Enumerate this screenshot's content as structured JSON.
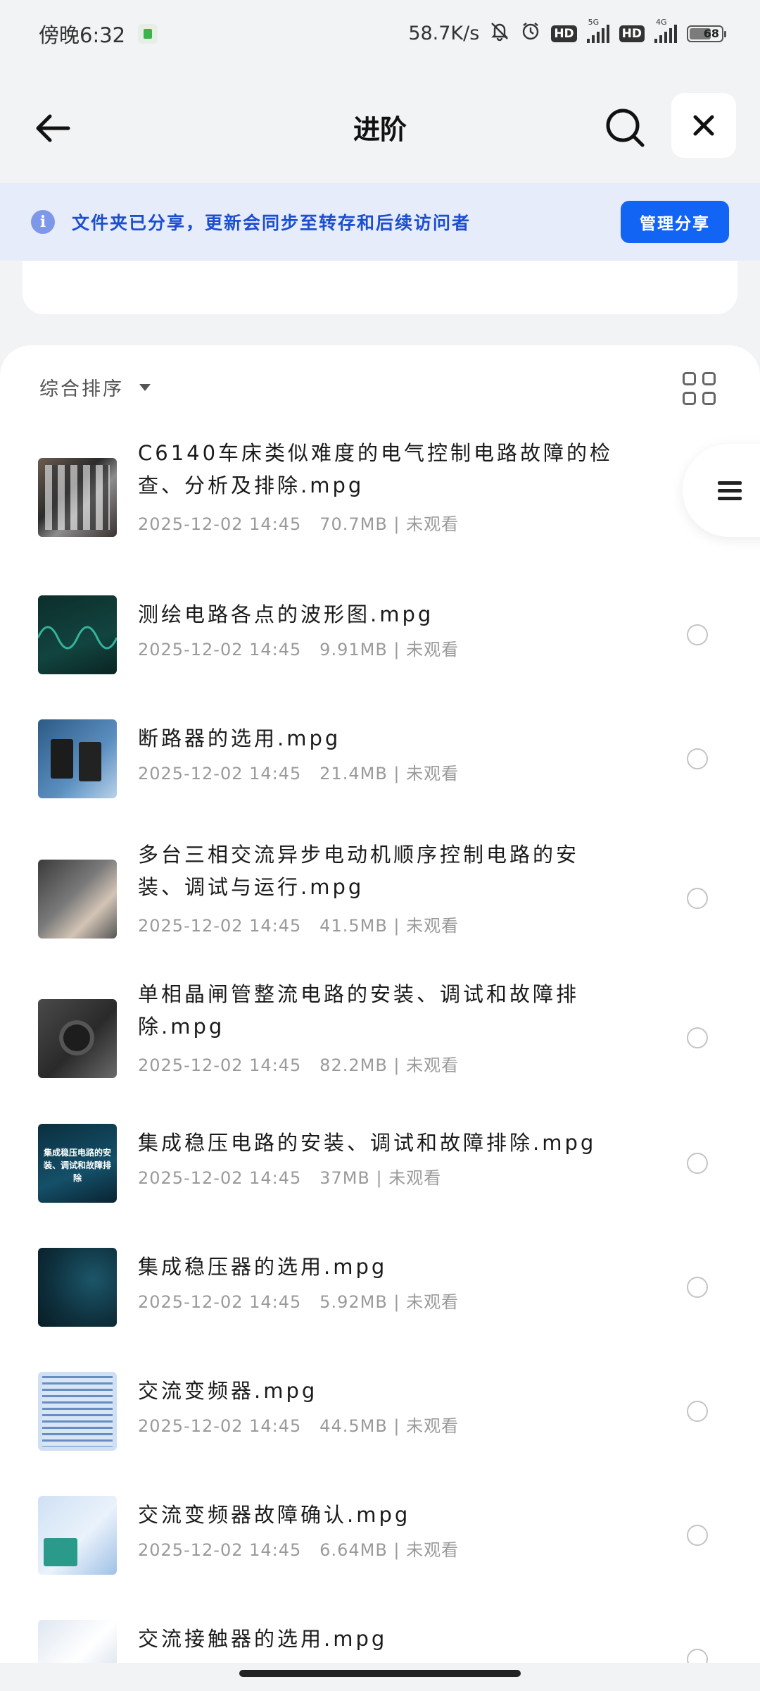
{
  "status_bar": {
    "time": "傍晚6:32",
    "network_speed": "58.7K/s",
    "hd1": "HD",
    "hd2": "HD",
    "signal1_tag": "5G",
    "signal2_tag": "4G",
    "battery_level": "68",
    "battery_fraction": 0.68
  },
  "header": {
    "title": "进阶"
  },
  "banner": {
    "text": "文件夹已分享，更新会同步至转存和后续访问者",
    "button": "管理分享"
  },
  "sort": {
    "label": "综合排序"
  },
  "files": [
    {
      "name": "C6140车床类似难度的电气控制电路故障的检查、分析及排除.mpg",
      "date": "2025-12-02  14:45",
      "size": "70.7MB",
      "status": "未观看"
    },
    {
      "name": "测绘电路各点的波形图.mpg",
      "date": "2025-12-02  14:45",
      "size": "9.91MB",
      "status": "未观看"
    },
    {
      "name": "断路器的选用.mpg",
      "date": "2025-12-02  14:45",
      "size": "21.4MB",
      "status": "未观看"
    },
    {
      "name": "多台三相交流异步电动机顺序控制电路的安装、调试与运行.mpg",
      "date": "2025-12-02  14:45",
      "size": "41.5MB",
      "status": "未观看"
    },
    {
      "name": "单相晶闸管整流电路的安装、调试和故障排除.mpg",
      "date": "2025-12-02  14:45",
      "size": "82.2MB",
      "status": "未观看"
    },
    {
      "name": "集成稳压电路的安装、调试和故障排除.mpg",
      "date": "2025-12-02  14:45",
      "size": "37MB",
      "status": "未观看",
      "thumb_text": "集成稳压电路的安装、调试和故障排除"
    },
    {
      "name": "集成稳压器的选用.mpg",
      "date": "2025-12-02  14:45",
      "size": "5.92MB",
      "status": "未观看"
    },
    {
      "name": "交流变频器.mpg",
      "date": "2025-12-02  14:45",
      "size": "44.5MB",
      "status": "未观看"
    },
    {
      "name": "交流变频器故障确认.mpg",
      "date": "2025-12-02  14:45",
      "size": "6.64MB",
      "status": "未观看"
    },
    {
      "name": "交流接触器的选用.mpg"
    }
  ],
  "colors": {
    "accent": "#1264f5",
    "banner_bg": "#e7ecfa",
    "banner_text": "#1b4fcf"
  }
}
